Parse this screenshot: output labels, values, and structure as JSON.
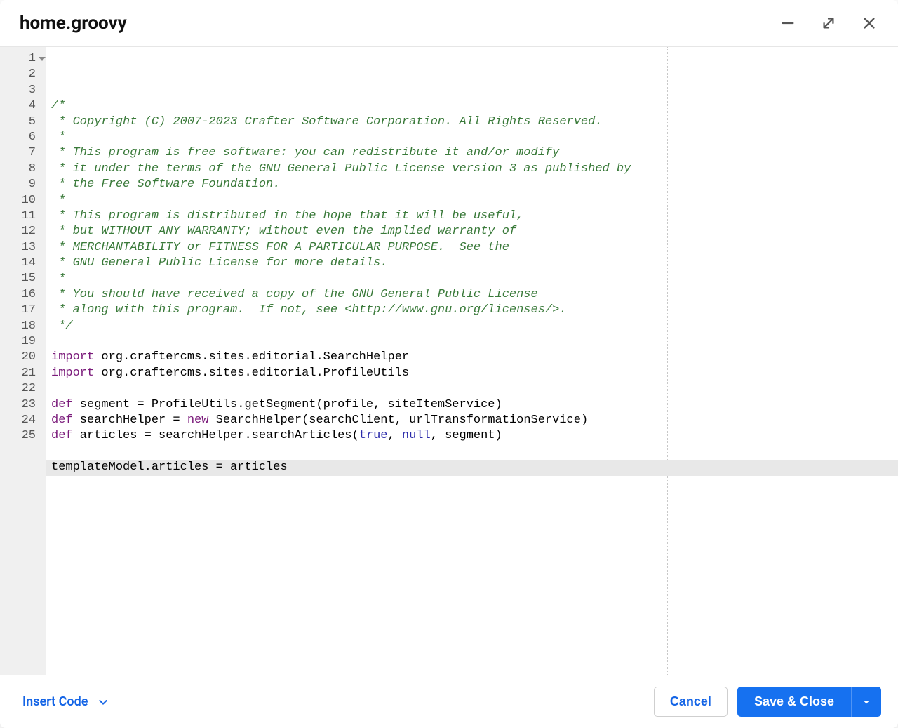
{
  "title": "home.groovy",
  "active_line": 24,
  "total_lines": 25,
  "code": {
    "lines": [
      {
        "n": 1,
        "t": "comment",
        "text": "/*"
      },
      {
        "n": 2,
        "t": "comment",
        "text": " * Copyright (C) 2007-2023 Crafter Software Corporation. All Rights Reserved."
      },
      {
        "n": 3,
        "t": "comment",
        "text": " *"
      },
      {
        "n": 4,
        "t": "comment",
        "text": " * This program is free software: you can redistribute it and/or modify"
      },
      {
        "n": 5,
        "t": "comment",
        "text": " * it under the terms of the GNU General Public License version 3 as published by"
      },
      {
        "n": 6,
        "t": "comment",
        "text": " * the Free Software Foundation."
      },
      {
        "n": 7,
        "t": "comment",
        "text": " *"
      },
      {
        "n": 8,
        "t": "comment",
        "text": " * This program is distributed in the hope that it will be useful,"
      },
      {
        "n": 9,
        "t": "comment",
        "text": " * but WITHOUT ANY WARRANTY; without even the implied warranty of"
      },
      {
        "n": 10,
        "t": "comment",
        "text": " * MERCHANTABILITY or FITNESS FOR A PARTICULAR PURPOSE.  See the"
      },
      {
        "n": 11,
        "t": "comment",
        "text": " * GNU General Public License for more details."
      },
      {
        "n": 12,
        "t": "comment",
        "text": " *"
      },
      {
        "n": 13,
        "t": "comment",
        "text": " * You should have received a copy of the GNU General Public License"
      },
      {
        "n": 14,
        "t": "comment",
        "text": " * along with this program.  If not, see <http://www.gnu.org/licenses/>."
      },
      {
        "n": 15,
        "t": "comment",
        "text": " */"
      },
      {
        "n": 16,
        "t": "blank",
        "text": ""
      },
      {
        "n": 17,
        "t": "import",
        "kw": "import",
        "rest": " org.craftercms.sites.editorial.SearchHelper"
      },
      {
        "n": 18,
        "t": "import",
        "kw": "import",
        "rest": " org.craftercms.sites.editorial.ProfileUtils"
      },
      {
        "n": 19,
        "t": "blank",
        "text": ""
      },
      {
        "n": 20,
        "t": "def",
        "kw": "def",
        "rest": " segment = ProfileUtils.getSegment(profile, siteItemService)"
      },
      {
        "n": 21,
        "t": "defnew",
        "kw": "def",
        "mid": " searchHelper = ",
        "kw2": "new",
        "rest": " SearchHelper(searchClient, urlTransformationService)"
      },
      {
        "n": 22,
        "t": "defcall",
        "kw": "def",
        "mid": " articles = searchHelper.searchArticles(",
        "a1": "true",
        "c1": ", ",
        "a2": "null",
        "rest": ", segment)"
      },
      {
        "n": 23,
        "t": "blank",
        "text": ""
      },
      {
        "n": 24,
        "t": "plain",
        "text": "templateModel.articles = articles"
      },
      {
        "n": 25,
        "t": "blank",
        "text": ""
      }
    ]
  },
  "footer": {
    "insert_code_label": "Insert Code",
    "cancel_label": "Cancel",
    "save_label": "Save & Close"
  }
}
